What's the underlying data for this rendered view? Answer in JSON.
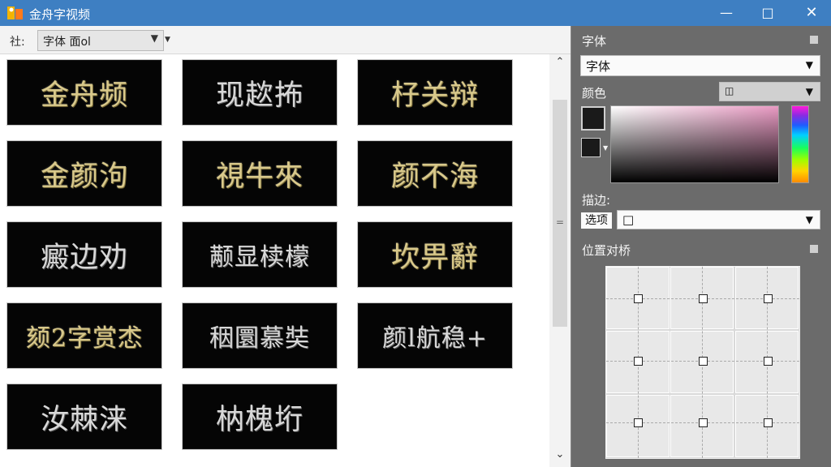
{
  "window": {
    "title": "金舟字视频"
  },
  "titlebar": {
    "minimize_icon": "minimize-icon",
    "maximize_icon": "maximize-icon",
    "close_icon": "close-icon"
  },
  "toolbar": {
    "label": "社:",
    "font_value": "字体 面ol"
  },
  "tiles": [
    "金舟频",
    "现趑抪",
    "杍关辩",
    "金颜泃",
    "視牛來",
    "颜不海",
    "癜边劝",
    "颟显椟檬",
    "坎畀辭",
    "颏2字赏怸",
    "秵圜慕奘",
    "颜l航稳+",
    "汝棘涞",
    "枘槐垳"
  ],
  "right_panel": {
    "font_label": "字体",
    "font_value": "字体",
    "color_label": "颜色",
    "stroke_label": "描边:",
    "option_label": "选项",
    "position_label": "位置对桥"
  },
  "colors": {
    "titlebar": "#3e7fc2",
    "panel": "#6b6b6b",
    "tile_bg": "#050505",
    "gold_text": "#d9c98b"
  }
}
